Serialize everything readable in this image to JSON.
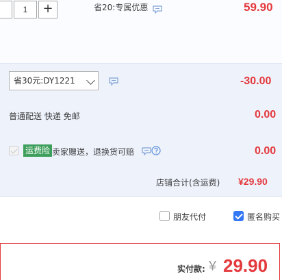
{
  "item": {
    "quantity": "1",
    "plus_label": "+",
    "promo_text": "省20:专属优惠",
    "price": "59.90"
  },
  "coupon": {
    "selected": "省30元:DY1221",
    "amount": "-30.00"
  },
  "shipping": {
    "label": "普通配送 快递 免邮",
    "amount": "0.00"
  },
  "insurance": {
    "badge": "运费险",
    "text": "卖家赠送，退换货可赔",
    "amount": "0.00"
  },
  "store_total": {
    "label": "店铺合计(含运费)",
    "amount": "¥29.90"
  },
  "options": {
    "friend_pay": "朋友代付",
    "anonymous": "匿名购买"
  },
  "payable": {
    "label": "实付款:",
    "currency": "¥",
    "amount": "29.90"
  },
  "colors": {
    "price": "#e4393c",
    "band": "#eef2fb",
    "badge": "#3e9f5c",
    "checkbox_checked": "#3478f6"
  },
  "icons": [
    "chat-bubble-icon",
    "help-icon",
    "checkmark-icon",
    "chevron-down-icon"
  ]
}
